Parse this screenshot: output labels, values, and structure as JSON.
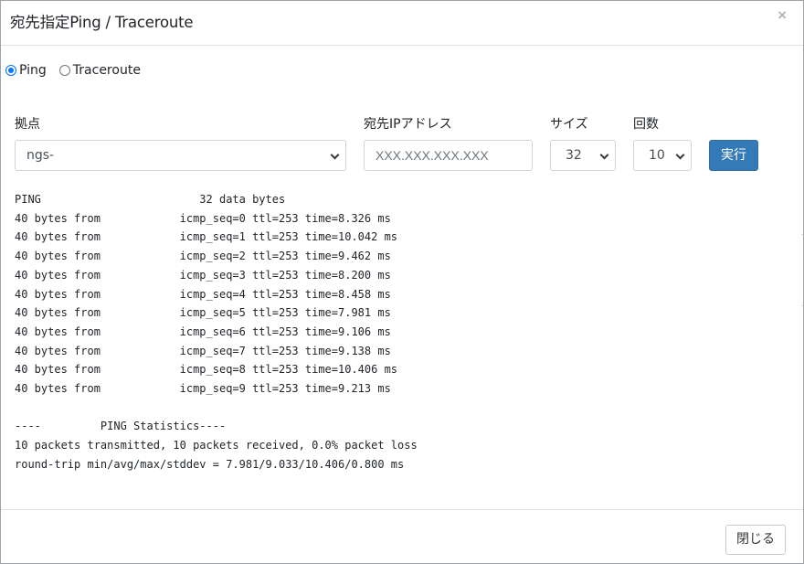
{
  "modal": {
    "title": "宛先指定Ping / Traceroute",
    "close_symbol": "×"
  },
  "mode": {
    "options": [
      {
        "label": "Ping",
        "checked": true
      },
      {
        "label": "Traceroute",
        "checked": false
      }
    ]
  },
  "form": {
    "site": {
      "label": "拠点",
      "value": "ngs-"
    },
    "dest_ip": {
      "label": "宛先IPアドレス",
      "placeholder": "XXX.XXX.XXX.XXX",
      "value": ""
    },
    "size": {
      "label": "サイズ",
      "value": "32"
    },
    "count": {
      "label": "回数",
      "value": "10"
    },
    "run_label": "実行"
  },
  "output": {
    "lines": [
      "PING                        32 data bytes",
      "40 bytes from            icmp_seq=0 ttl=253 time=8.326 ms",
      "40 bytes from            icmp_seq=1 ttl=253 time=10.042 ms",
      "40 bytes from            icmp_seq=2 ttl=253 time=9.462 ms",
      "40 bytes from            icmp_seq=3 ttl=253 time=8.200 ms",
      "40 bytes from            icmp_seq=4 ttl=253 time=8.458 ms",
      "40 bytes from            icmp_seq=5 ttl=253 time=7.981 ms",
      "40 bytes from            icmp_seq=6 ttl=253 time=9.106 ms",
      "40 bytes from            icmp_seq=7 ttl=253 time=9.138 ms",
      "40 bytes from            icmp_seq=8 ttl=253 time=10.406 ms",
      "40 bytes from            icmp_seq=9 ttl=253 time=9.213 ms",
      "",
      "----         PING Statistics----",
      "10 packets transmitted, 10 packets received, 0.0% packet loss",
      "round-trip min/avg/max/stddev = 7.981/9.033/10.406/0.800 ms"
    ]
  },
  "footer": {
    "close_label": "閉じる"
  },
  "colors": {
    "primary": "#337ab7",
    "radio_accent": "#0075ff"
  }
}
